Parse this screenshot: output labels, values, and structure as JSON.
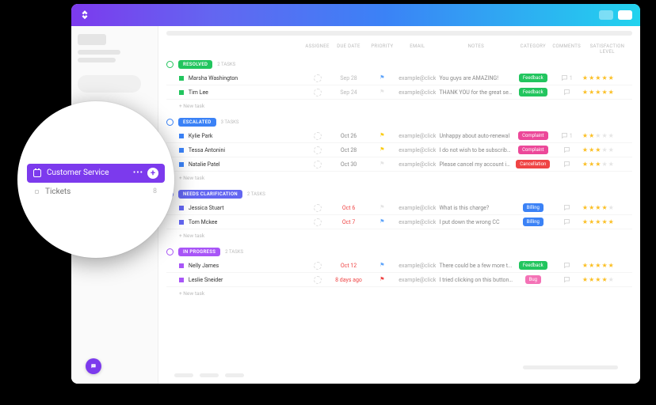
{
  "lens": {
    "folder_label": "Customer Service",
    "sub_label": "Tickets",
    "sub_count": "8"
  },
  "columns": {
    "assignee": "ASSIGNEE",
    "due_date": "DUE DATE",
    "priority": "PRIORITY",
    "email": "EMAIL",
    "notes": "NOTES",
    "category": "CATEGORY",
    "comments": "COMMENTS",
    "satisfaction": "SATISFACTION LEVEL"
  },
  "new_task_label": "+ New task",
  "groups": [
    {
      "status": "RESOLVED",
      "color": "#22c55e",
      "circ_color": "#22c55e",
      "count_label": "2 TASKS",
      "tasks": [
        {
          "sq": "#22c55e",
          "name": "Marsha Washington",
          "date": "Sep 28",
          "date_color": "#bbb",
          "flag": "blue",
          "email": "example@click",
          "notes": "You guys are AMAZING!",
          "cat": "Feedback",
          "cat_color": "#22c55e",
          "com": "1",
          "stars": 5
        },
        {
          "sq": "#22c55e",
          "name": "Tim Lee",
          "date": "Sep 24",
          "date_color": "#bbb",
          "flag": "none",
          "email": "example@click",
          "notes": "THANK YOU for the great se...",
          "cat": "Feedback",
          "cat_color": "#22c55e",
          "com": "",
          "stars": 5
        }
      ]
    },
    {
      "status": "ESCALATED",
      "color": "#3b82f6",
      "circ_color": "#3b82f6",
      "count_label": "3 TASKS",
      "tasks": [
        {
          "sq": "#3b82f6",
          "name": "Kylie Park",
          "date": "Oct 26",
          "date_color": "#888",
          "flag": "yellow",
          "email": "example@click",
          "notes": "Unhappy about auto-renewal",
          "cat": "Complaint",
          "cat_color": "#ec4899",
          "com": "1",
          "stars": 2
        },
        {
          "sq": "#3b82f6",
          "name": "Tessa Antonini",
          "date": "Oct 28",
          "date_color": "#888",
          "flag": "yellow",
          "email": "example@click",
          "notes": "I do not wish to be subscribe...",
          "cat": "Complaint",
          "cat_color": "#ec4899",
          "com": "",
          "stars": 3
        },
        {
          "sq": "#3b82f6",
          "name": "Natalie Patel",
          "date": "Oct 30",
          "date_color": "#888",
          "flag": "none",
          "email": "example@click",
          "notes": "Please cancel my account im...",
          "cat": "Cancellation",
          "cat_color": "#ef4444",
          "com": "",
          "stars": 3
        }
      ]
    },
    {
      "status": "NEEDS CLARIFICATION",
      "color": "#6366f1",
      "circ_color": "#6366f1",
      "count_label": "2 TASKS",
      "tasks": [
        {
          "sq": "#6366f1",
          "name": "Jessica Stuart",
          "date": "Oct 6",
          "date_color": "#ef4444",
          "flag": "none",
          "email": "example@click",
          "notes": "What is this charge?",
          "cat": "Billing",
          "cat_color": "#3b82f6",
          "com": "",
          "stars": 4
        },
        {
          "sq": "#6366f1",
          "name": "Tom Mckee",
          "date": "Oct 7",
          "date_color": "#ef4444",
          "flag": "blue",
          "email": "example@click",
          "notes": "I put down the wrong CC",
          "cat": "Billing",
          "cat_color": "#3b82f6",
          "com": "",
          "stars": 5
        }
      ]
    },
    {
      "status": "IN PROGRESS",
      "color": "#a855f7",
      "circ_color": "#a855f7",
      "count_label": "2 TASKS",
      "tasks": [
        {
          "sq": "#a855f7",
          "name": "Nelly James",
          "date": "Oct 12",
          "date_color": "#ef4444",
          "flag": "blue",
          "email": "example@click",
          "notes": "There could be a few more t...",
          "cat": "Feedback",
          "cat_color": "#22c55e",
          "com": "",
          "stars": 5
        },
        {
          "sq": "#a855f7",
          "name": "Leslie Sneider",
          "date": "8 days ago",
          "date_color": "#ef4444",
          "flag": "red",
          "email": "example@click",
          "notes": "I tried clicking on this button...",
          "cat": "Bug",
          "cat_color": "#f472b6",
          "com": "",
          "stars": 4
        }
      ]
    }
  ]
}
